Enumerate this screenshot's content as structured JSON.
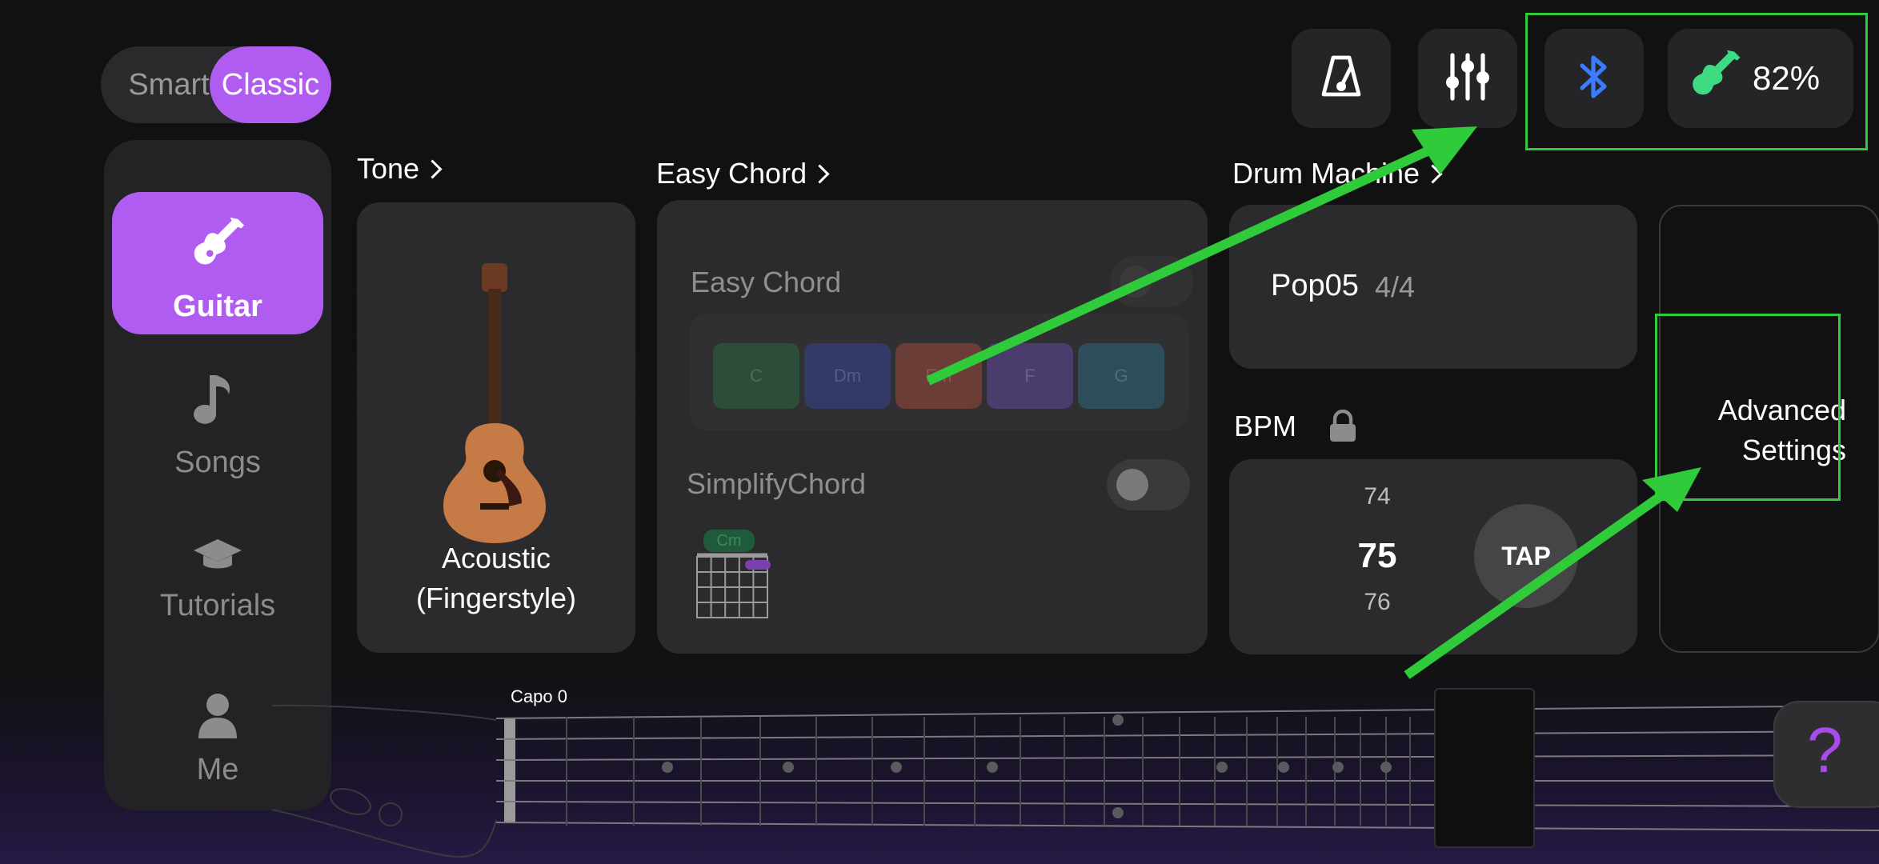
{
  "mode": {
    "smart": "Smart",
    "classic": "Classic",
    "selected": "Classic"
  },
  "sidebar": {
    "items": [
      {
        "label": "Guitar",
        "icon": "guitar-icon",
        "active": true
      },
      {
        "label": "Songs",
        "icon": "music-note-icon",
        "active": false
      },
      {
        "label": "Tutorials",
        "icon": "graduation-cap-icon",
        "active": false
      },
      {
        "label": "Me",
        "icon": "person-icon",
        "active": false
      }
    ]
  },
  "top_bar": {
    "metronome_icon": "metronome-icon",
    "mixer_icon": "sliders-icon",
    "bluetooth_icon": "bluetooth-icon",
    "battery": "82%"
  },
  "tone": {
    "title": "Tone",
    "name_line1": "Acoustic",
    "name_line2": "(Fingerstyle)"
  },
  "easy_chord": {
    "title": "Easy Chord",
    "toggle_label": "Easy Chord",
    "chords": [
      "C",
      "Dm",
      "Em",
      "F",
      "G"
    ],
    "simplify_label": "SimplifyChord",
    "chord_tag": "Cm"
  },
  "drum": {
    "title": "Drum Machine",
    "pattern": "Pop05",
    "time_signature": "4/4"
  },
  "bpm": {
    "label": "BPM",
    "prev": "74",
    "current": "75",
    "next": "76",
    "tap": "TAP"
  },
  "advanced": {
    "line1": "Advanced",
    "line2": "Settings"
  },
  "fretboard": {
    "capo": "Capo 0"
  },
  "help": {
    "label": "?"
  },
  "colors": {
    "accent": "#b15cf0",
    "highlight": "#2fcb3a",
    "bluetooth": "#3a7bff",
    "battery_green": "#3ddc84"
  }
}
